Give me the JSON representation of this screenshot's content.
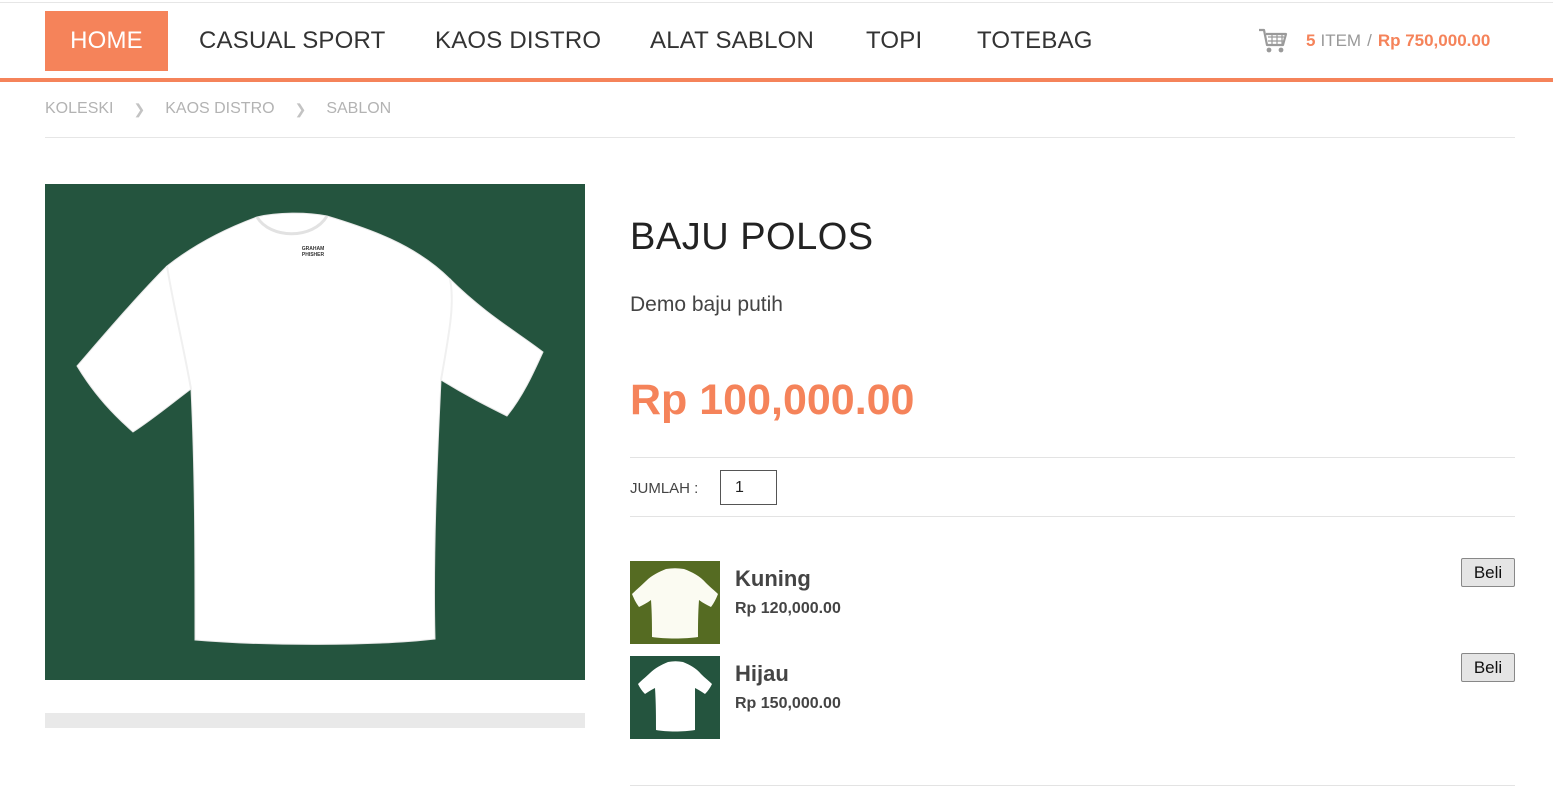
{
  "nav": {
    "items": [
      {
        "label": "HOME"
      },
      {
        "label": "CASUAL SPORT"
      },
      {
        "label": "KAOS DISTRO"
      },
      {
        "label": "ALAT SABLON"
      },
      {
        "label": "TOPI"
      },
      {
        "label": "TOTEBAG"
      }
    ]
  },
  "cart": {
    "count": "5",
    "item_label": "ITEM",
    "separator": "/",
    "total": "Rp 750,000.00",
    "icon": "cart-icon"
  },
  "breadcrumb": {
    "items": [
      "KOLESKI",
      "KAOS DISTRO",
      "SABLON"
    ]
  },
  "product": {
    "title": "BAJU POLOS",
    "description": "Demo baju putih",
    "price": "Rp 100,000.00",
    "image_bg": "#24543e",
    "shirt_label_line1": "GRAHAM",
    "shirt_label_line2": "PHISHER"
  },
  "quantity": {
    "label": "JUMLAH :",
    "value": "1"
  },
  "variants": [
    {
      "name": "Kuning",
      "price": "Rp 120,000.00",
      "button": "Beli",
      "thumb_bg": "#556b22"
    },
    {
      "name": "Hijau",
      "price": "Rp 150,000.00",
      "button": "Beli",
      "thumb_bg": "#24543e"
    }
  ],
  "colors": {
    "accent": "#f5835a"
  }
}
